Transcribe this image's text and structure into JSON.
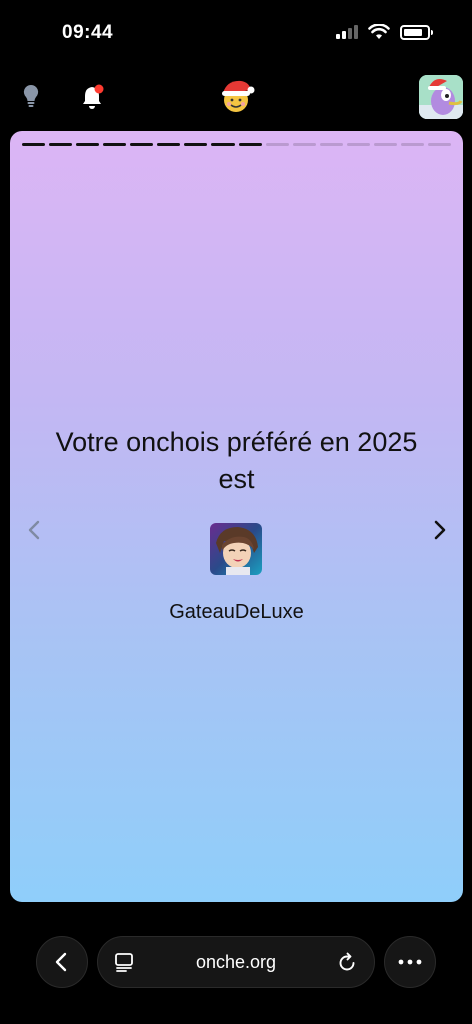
{
  "status_bar": {
    "time": "09:44",
    "battery_level": 0.8
  },
  "app_bar": {
    "icons": [
      "lightbulb-icon",
      "bell-icon",
      "santa-emoji-icon",
      "user-avatar"
    ],
    "notification_dot_color": "#ff3b30"
  },
  "story": {
    "total_segments": 16,
    "completed_segments": 9,
    "headline": "Votre onchois préféré en 2025 est",
    "favorite_user": "GateauDeLuxe",
    "gradient_top": "#dcb5f5",
    "gradient_bottom": "#8fcefa"
  },
  "browser_bar": {
    "url": "onche.org"
  }
}
